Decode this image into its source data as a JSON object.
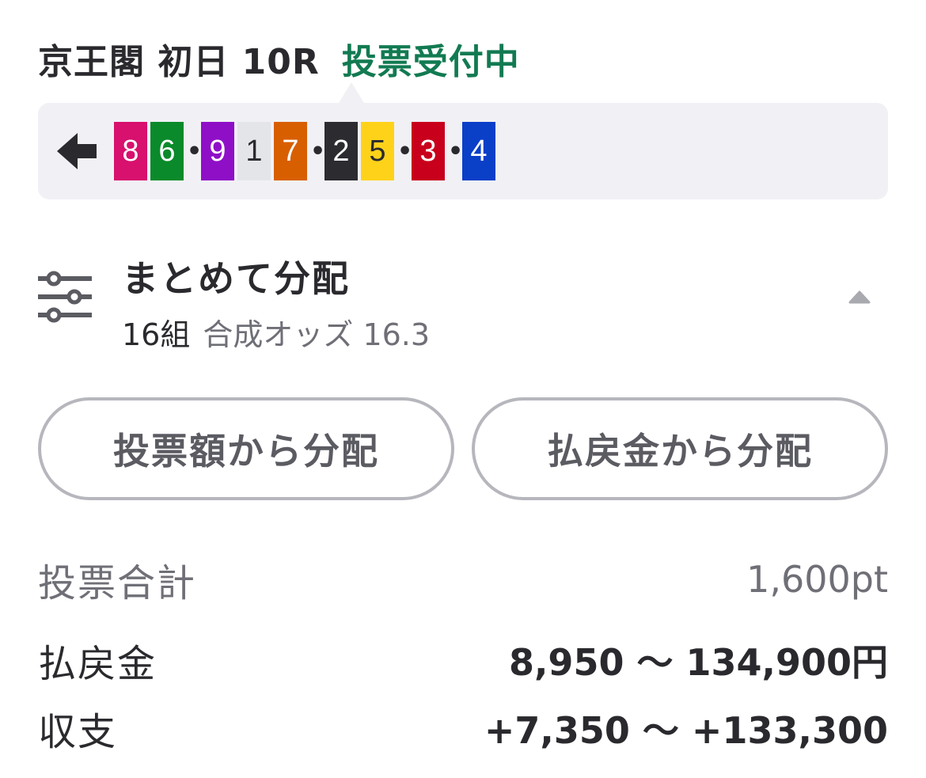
{
  "header": {
    "race_title": "京王閣 初日 10R",
    "status": "投票受付中"
  },
  "combination": {
    "groups": [
      [
        {
          "number": "8",
          "color": "#d8106e",
          "text_color": "#ffffff"
        },
        {
          "number": "6",
          "color": "#0a8a2a",
          "text_color": "#ffffff"
        }
      ],
      [
        {
          "number": "9",
          "color": "#8f0fc7",
          "text_color": "#ffffff"
        },
        {
          "number": "1",
          "color": "#e3e5e8",
          "text_color": "#2a2a2e"
        },
        {
          "number": "7",
          "color": "#d85f00",
          "text_color": "#ffffff"
        }
      ],
      [
        {
          "number": "2",
          "color": "#2b2b30",
          "text_color": "#ffffff"
        },
        {
          "number": "5",
          "color": "#ffd21a",
          "text_color": "#2a2a2e"
        }
      ],
      [
        {
          "number": "3",
          "color": "#c8001c",
          "text_color": "#ffffff"
        }
      ],
      [
        {
          "number": "4",
          "color": "#0a3fc8",
          "text_color": "#ffffff"
        }
      ]
    ]
  },
  "distribution": {
    "title": "まとめて分配",
    "count": "16組",
    "odds": "合成オッズ 16.3"
  },
  "buttons": {
    "by_stake": "投票額から分配",
    "by_payout": "払戻金から分配"
  },
  "summary": {
    "total_label": "投票合計",
    "total_value": "1,600pt",
    "payout_label": "払戻金",
    "payout_value": "8,950 〜 134,900円",
    "balance_label": "収支",
    "balance_value": "+7,350 〜 +133,300"
  }
}
